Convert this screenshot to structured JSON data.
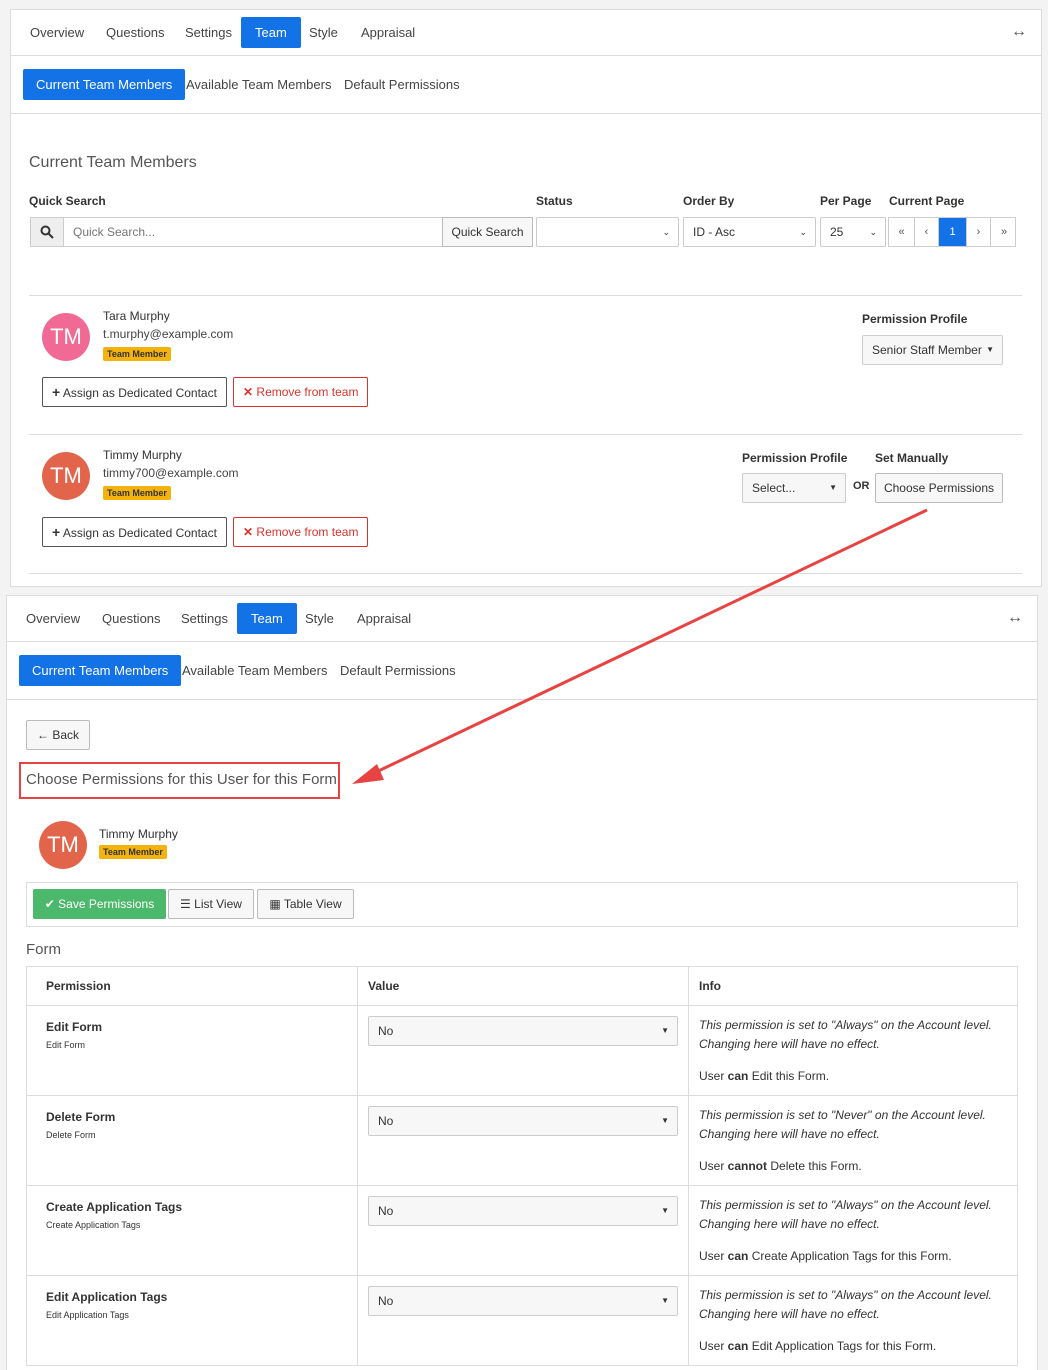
{
  "tabs": [
    "Overview",
    "Questions",
    "Settings",
    "Team",
    "Style",
    "Appraisal"
  ],
  "subtabs": [
    "Current Team Members",
    "Available Team Members",
    "Default Permissions"
  ],
  "top": {
    "heading": "Current Team Members",
    "labels": {
      "quick_search": "Quick Search",
      "status": "Status",
      "order_by": "Order By",
      "per_page": "Per Page",
      "current_page": "Current Page"
    },
    "search_placeholder": "Quick Search...",
    "search_button": "Quick Search",
    "order_by_value": "ID - Asc",
    "per_page_value": "25",
    "pager": [
      "«",
      "‹",
      "1",
      "›",
      "»"
    ],
    "members": [
      {
        "initials": "TM",
        "name": "Tara Murphy",
        "email": "t.murphy@example.com",
        "badge": "Team Member",
        "assign": "Assign as Dedicated Contact",
        "remove": "Remove from team",
        "perm_label": "Permission Profile",
        "perm_value": "Senior Staff Member",
        "avatar_color": "#f06a95"
      },
      {
        "initials": "TM",
        "name": "Timmy Murphy",
        "email": "timmy700@example.com",
        "badge": "Team Member",
        "assign": "Assign as Dedicated Contact",
        "remove": "Remove from team",
        "perm_label": "Permission Profile",
        "perm_value": "Select...",
        "or_label": "OR",
        "set_manually": "Set Manually",
        "choose_btn": "Choose Permissions",
        "avatar_color": "#e2654b"
      }
    ]
  },
  "bottom": {
    "back": "Back",
    "heading": "Choose Permissions for this User for this Form",
    "user_initials": "TM",
    "user_name": "Timmy Murphy",
    "user_badge": "Team Member",
    "save": "Save Permissions",
    "list_view": "List View",
    "table_view": "Table View",
    "section": "Form",
    "columns": [
      "Permission",
      "Value",
      "Info"
    ],
    "rows": [
      {
        "name": "Edit Form",
        "desc": "Edit Form",
        "value": "No",
        "info1": "This permission is set to \"Always\" on the Account level.",
        "info2": "Changing here will have no effect.",
        "pre": "User ",
        "strong": "can",
        "post": " Edit this Form."
      },
      {
        "name": "Delete Form",
        "desc": "Delete Form",
        "value": "No",
        "info1": "This permission is set to \"Never\" on the Account level.",
        "info2": "Changing here will have no effect.",
        "pre": "User ",
        "strong": "cannot",
        "post": " Delete this Form."
      },
      {
        "name": "Create Application Tags",
        "desc": "Create Application Tags",
        "value": "No",
        "info1": "This permission is set to \"Always\" on the Account level.",
        "info2": "Changing here will have no effect.",
        "pre": "User ",
        "strong": "can",
        "post": " Create Application Tags for this Form."
      },
      {
        "name": "Edit Application Tags",
        "desc": "Edit Application Tags",
        "value": "No",
        "info1": "This permission is set to \"Always\" on the Account level.",
        "info2": "Changing here will have no effect.",
        "pre": "User ",
        "strong": "can",
        "post": " Edit Application Tags for this Form."
      }
    ]
  },
  "colors": {
    "primary": "#1272e6",
    "success": "#4cb86b",
    "danger": "#d9342b",
    "badge": "#f4b30c",
    "annotation": "#e84343"
  }
}
